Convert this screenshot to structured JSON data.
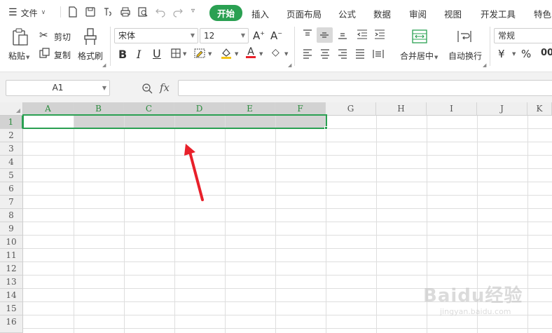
{
  "menubar": {
    "menu_label": "文件",
    "tabs": [
      "开始",
      "插入",
      "页面布局",
      "公式",
      "数据",
      "审阅",
      "视图",
      "开发工具",
      "特色"
    ],
    "active_tab": "开始"
  },
  "clipboard": {
    "paste": "粘贴",
    "cut": "剪切",
    "copy": "复制",
    "format_painter": "格式刷"
  },
  "font": {
    "name": "宋体",
    "size": "12"
  },
  "alignment": {
    "merge_center": "合并居中",
    "wrap_text": "自动换行"
  },
  "number": {
    "format": "常规",
    "currency": "¥",
    "percent": "%"
  },
  "formula_bar": {
    "cell_ref": "A1",
    "fx": "fx"
  },
  "sheet": {
    "columns": [
      "A",
      "B",
      "C",
      "D",
      "E",
      "F",
      "G",
      "H",
      "I",
      "J",
      "K"
    ],
    "rows": [
      "1",
      "2",
      "3",
      "4",
      "5",
      "6",
      "7",
      "8",
      "9",
      "10",
      "11",
      "12",
      "13",
      "14",
      "15",
      "16"
    ]
  },
  "watermark": {
    "text": "Baidu经验",
    "sub": "jingyan.baidu.com"
  },
  "colors": {
    "accent": "#2aa052",
    "arrow": "#e8202a",
    "font_color": "#e8202a",
    "fill_color": "#f5c518"
  }
}
